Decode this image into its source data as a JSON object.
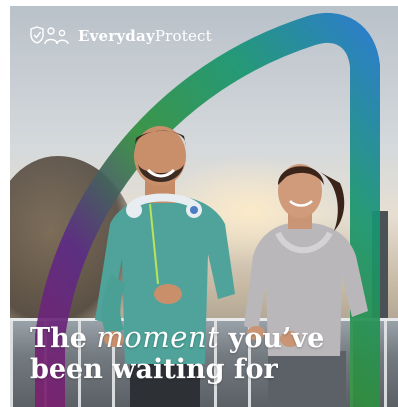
{
  "brand": {
    "name_bold": "Everyday",
    "name_light": "Protect",
    "icon": "people-shield-icon"
  },
  "headline": {
    "word_1": "The",
    "word_script": "moment",
    "word_2": "you’ve",
    "line_2": "been waiting for"
  },
  "colors": {
    "arch_start": "#7a1f6e",
    "arch_mid": "#2f8f3c",
    "arch_end": "#1f79c6",
    "text": "#ffffff"
  }
}
